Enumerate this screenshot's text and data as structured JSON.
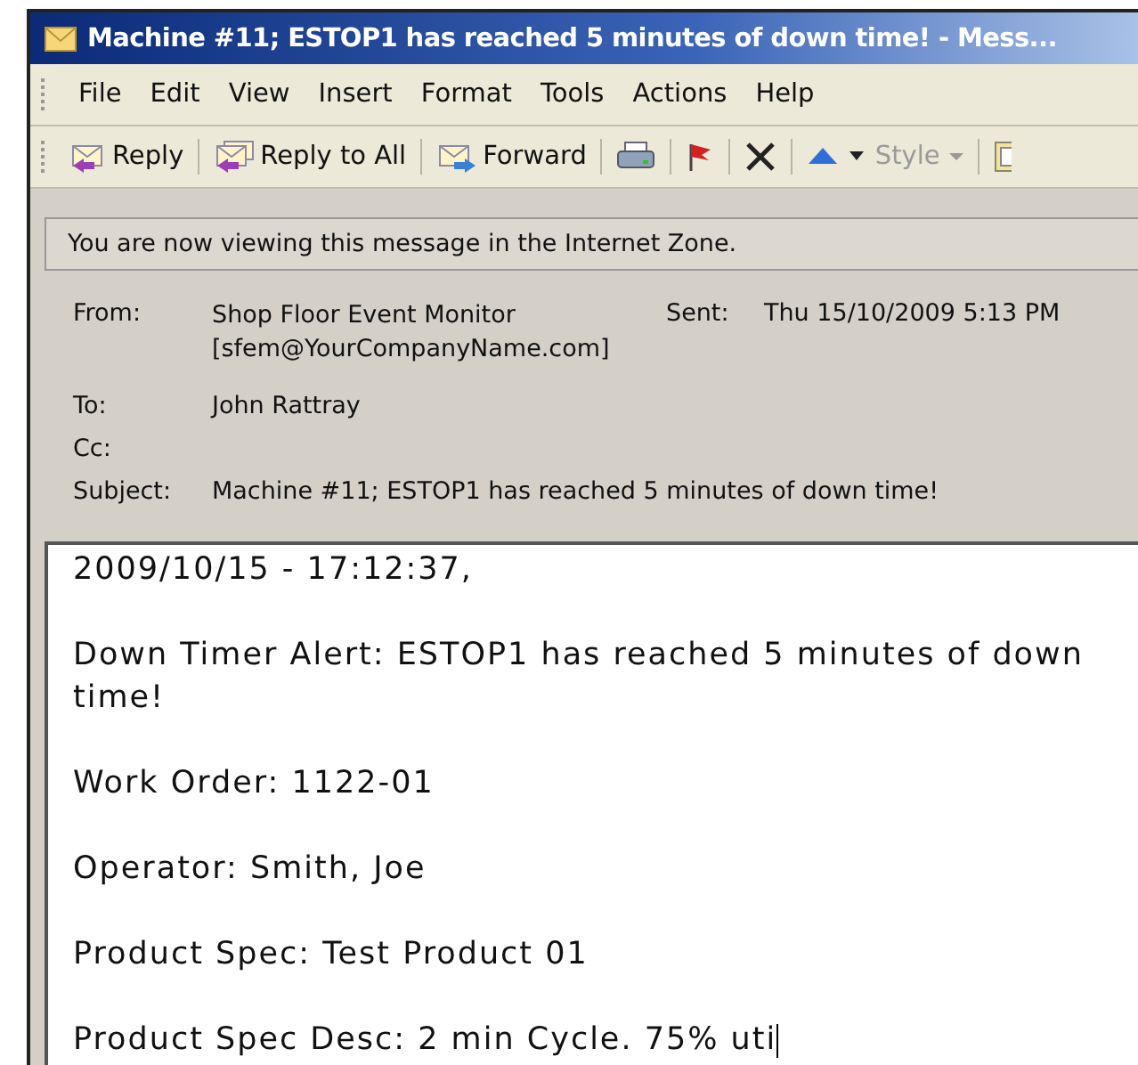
{
  "window": {
    "title": "Machine #11; ESTOP1 has reached 5 minutes of down time! - Mess..."
  },
  "menu": [
    {
      "label": "File"
    },
    {
      "label": "Edit"
    },
    {
      "label": "View"
    },
    {
      "label": "Insert"
    },
    {
      "label": "Format"
    },
    {
      "label": "Tools"
    },
    {
      "label": "Actions"
    },
    {
      "label": "Help"
    }
  ],
  "toolbar": [
    {
      "kind": "reply",
      "label": "Reply",
      "disabled": false
    },
    {
      "kind": "sep"
    },
    {
      "kind": "replyall",
      "label": "Reply to All",
      "disabled": false
    },
    {
      "kind": "sep"
    },
    {
      "kind": "forward",
      "label": "Forward",
      "disabled": false
    },
    {
      "kind": "sep"
    },
    {
      "kind": "print",
      "disabled": false
    },
    {
      "kind": "sep"
    },
    {
      "kind": "flag",
      "disabled": false
    },
    {
      "kind": "sep"
    },
    {
      "kind": "delete",
      "disabled": false
    },
    {
      "kind": "sep"
    },
    {
      "kind": "up",
      "disabled": false
    },
    {
      "kind": "caret",
      "disabled": false
    },
    {
      "kind": "style",
      "label": "Style",
      "disabled": true
    },
    {
      "kind": "sep"
    },
    {
      "kind": "paste",
      "disabled": false
    }
  ],
  "info_bar": "You are now viewing this message in the Internet Zone.",
  "header": {
    "from_label": "From:",
    "from": "Shop Floor Event Monitor",
    "from_address": "[sfem@YourCompanyName.com]",
    "sent_label": "Sent:",
    "sent": "Thu 15/10/2009 5:13 PM",
    "to_label": "To:",
    "to": "John Rattray",
    "cc_label": "Cc:",
    "subject_label": "Subject:",
    "subject": "Machine #11; ESTOP1 has reached 5 minutes of down time!"
  },
  "body": [
    "2009/10/15 - 17:12:37,",
    "Down Timer Alert: ESTOP1 has reached 5 minutes of down time!",
    "Work Order: 1122-01",
    "Operator: Smith, Joe",
    "Product Spec: Test Product 01",
    "Product Spec Desc: 2 min Cycle. 75% uti"
  ]
}
